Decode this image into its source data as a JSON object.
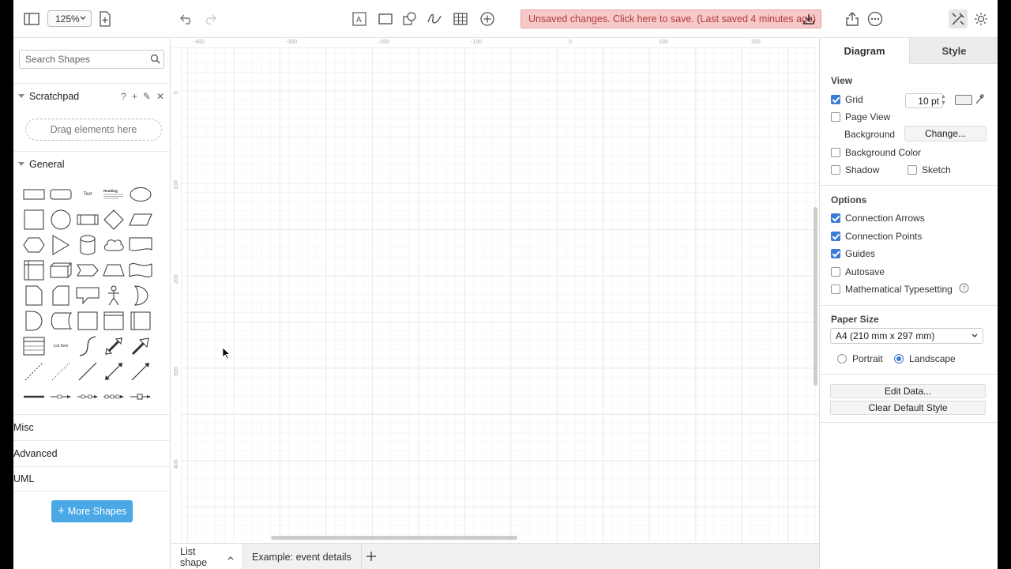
{
  "toolbar": {
    "zoom_value": "125%",
    "unsaved_message": "Unsaved changes. Click here to save. (Last saved 4 minutes ago)",
    "icons": [
      "sidebar-toggle-icon",
      "new-page-icon",
      "undo-icon",
      "redo-icon",
      "text-icon",
      "rectangle-icon",
      "shapes-icon",
      "freehand-icon",
      "table-icon",
      "insert-icon",
      "download-icon",
      "share-icon",
      "more-icon",
      "format-icon",
      "theme-icon"
    ]
  },
  "left_panel": {
    "search_placeholder": "Search Shapes",
    "scratchpad": {
      "title": "Scratchpad",
      "actions": [
        "?",
        "+",
        "✎",
        "✕"
      ],
      "drop_hint": "Drag elements here"
    },
    "general": {
      "title": "General",
      "shape_text_label": "Text",
      "shape_heading_label": "Heading",
      "shape_listitem_label": "List Item"
    },
    "collapsed_sections": [
      "Misc",
      "Advanced",
      "UML"
    ],
    "more_shapes_label": "More Shapes"
  },
  "canvas": {
    "ruler_top_labels": [
      "-400",
      "-300",
      "-200",
      "-100",
      "0",
      "100",
      "200"
    ],
    "ruler_left_labels": [
      "0",
      "100",
      "200",
      "300",
      "400"
    ]
  },
  "page_tabs": [
    {
      "label": "List shape",
      "active": true
    },
    {
      "label": "Example: event details",
      "active": false
    }
  ],
  "format_panel": {
    "tabs": [
      "Diagram",
      "Style"
    ],
    "view": {
      "title": "View",
      "grid_label": "Grid",
      "grid_checked": true,
      "grid_size": "10 pt",
      "page_view_label": "Page View",
      "page_view_checked": false,
      "background_label": "Background",
      "change_button": "Change...",
      "background_color_label": "Background Color",
      "shadow_label": "Shadow",
      "sketch_label": "Sketch"
    },
    "options": {
      "title": "Options",
      "items": [
        {
          "label": "Connection Arrows",
          "checked": true
        },
        {
          "label": "Connection Points",
          "checked": true
        },
        {
          "label": "Guides",
          "checked": true
        },
        {
          "label": "Autosave",
          "checked": false
        },
        {
          "label": "Mathematical Typesetting",
          "checked": false
        }
      ]
    },
    "paper": {
      "title": "Paper Size",
      "selected": "A4 (210 mm x 297 mm)",
      "portrait_label": "Portrait",
      "landscape_label": "Landscape",
      "orientation": "landscape"
    },
    "buttons": [
      "Edit Data...",
      "Clear Default Style"
    ]
  },
  "colors": {
    "accent": "#3a7bd5",
    "unsaved_bg": "#f7c8c8",
    "unsaved_text": "#b03b3b",
    "more_shapes_bg": "#4aa8e7"
  }
}
